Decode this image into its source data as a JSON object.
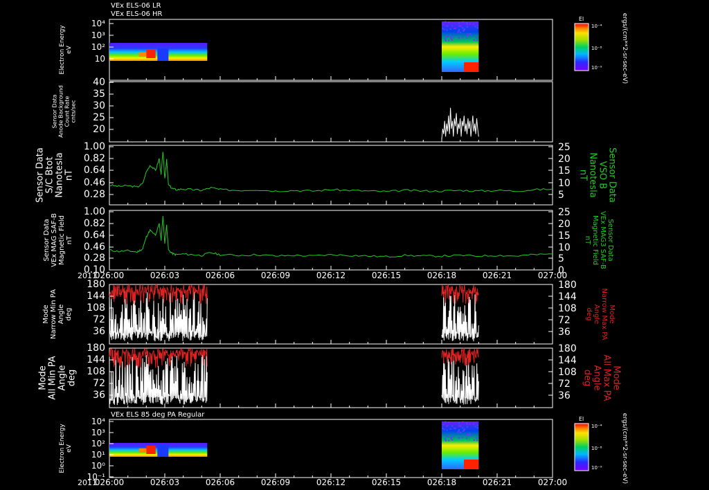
{
  "chart_data": {
    "type": "line",
    "title_lines": [
      "VEx ELS-06 LR",
      "VEx ELS-06 HR"
    ],
    "bottom_title": "VEx ELS 85 deg PA Regular",
    "year": "2011",
    "time_labels": [
      "026:00",
      "026:03",
      "026:06",
      "026:09",
      "026:12",
      "026:15",
      "026:18",
      "026:21",
      "027:00"
    ],
    "panels": [
      {
        "id": "spec1",
        "kind": "spectrogram",
        "ylabel": [
          "Electron Energy",
          "eV"
        ],
        "yticks": [
          "10⁴",
          "10³",
          "10²",
          "10"
        ],
        "colorbar": {
          "title": "El",
          "ticks": [
            "10⁻⁴",
            "10⁻⁸",
            "10⁻⁹"
          ],
          "unit": "ergs/(cm**2-sr-sec-eV)"
        },
        "data_blocks": [
          {
            "t_start": "026:00",
            "t_end": "026:05.3",
            "content": "low-energy flux, peak near 026:02-026:03"
          },
          {
            "t_start": "026:18",
            "t_end": "026:20",
            "content": "broad-energy flux, peak near 026:19.5"
          }
        ]
      },
      {
        "id": "bkg",
        "kind": "line",
        "ylabel": [
          "Sensor Data",
          "Anode Background",
          "Count Rate",
          "cnts/sec"
        ],
        "ylim": [
          17,
          40
        ],
        "yticks": [
          "40",
          "35",
          "30",
          "25",
          "20"
        ],
        "series": [
          {
            "color": "#ffffff",
            "x_start": 18.0,
            "x_end": 20.0,
            "values": [
              18,
              22,
              20,
              25,
              19,
              24,
              21,
              27,
              20,
              30,
              22,
              25,
              19,
              26,
              23,
              28,
              20,
              24,
              22,
              26,
              19,
              25,
              23,
              27,
              21,
              24,
              20,
              26,
              22,
              25,
              19,
              23,
              27,
              21,
              24,
              20,
              26,
              22,
              19
            ]
          }
        ]
      },
      {
        "id": "bsc",
        "kind": "line",
        "ylabel": [
          "Sensor Data",
          "S/C Btot",
          "Nanotesla",
          "nT"
        ],
        "ylim_left": [
          0.1,
          1.0
        ],
        "yticks_left": [
          "1.00",
          "0.82",
          "0.64",
          "0.46",
          "0.28"
        ],
        "ylabel_right": [
          "Sensor Data",
          "VSO B",
          "Nanotesla",
          "nT"
        ],
        "yticks_right": [
          "25",
          "20",
          "15",
          "10",
          "5"
        ],
        "series": [
          {
            "color": "#22cc22",
            "x": [
              0,
              0.5,
              1,
              1.5,
              1.8,
              2.0,
              2.2,
              2.5,
              2.7,
              2.8,
              2.9,
              3.0,
              3.1,
              3.2,
              3.4,
              3.6,
              4,
              4.5,
              5,
              5.5,
              6,
              7,
              8,
              9,
              10,
              11,
              12,
              13,
              14,
              15,
              16,
              17,
              18,
              19,
              20,
              21,
              22,
              23,
              24
            ],
            "y": [
              0.4,
              0.38,
              0.39,
              0.37,
              0.42,
              0.6,
              0.7,
              0.62,
              0.8,
              0.55,
              0.91,
              0.5,
              0.78,
              0.4,
              0.35,
              0.33,
              0.34,
              0.33,
              0.32,
              0.36,
              0.33,
              0.32,
              0.33,
              0.31,
              0.32,
              0.31,
              0.33,
              0.32,
              0.31,
              0.3,
              0.32,
              0.31,
              0.31,
              0.32,
              0.31,
              0.32,
              0.31,
              0.33,
              0.34
            ]
          }
        ]
      },
      {
        "id": "bmag",
        "kind": "line",
        "ylabel": [
          "Sensor Data",
          "VEx MAG SAF-B",
          "Magnetic Field",
          "nT"
        ],
        "ylim_left": [
          0.1,
          1.0
        ],
        "yticks_left": [
          "1.00",
          "0.82",
          "0.64",
          "0.46",
          "0.28",
          "0.10"
        ],
        "ylabel_right": [
          "Sensor Data",
          "VEx MAG3 SAF-B",
          "Magnetic Field",
          "nT"
        ],
        "yticks_right": [
          "25",
          "20",
          "15",
          "10",
          "5",
          "0"
        ],
        "series": [
          {
            "color": "#22cc22",
            "x": [
              0,
              0.5,
              1,
              1.5,
              1.8,
              2.0,
              2.2,
              2.5,
              2.7,
              2.8,
              2.9,
              3.0,
              3.1,
              3.2,
              3.4,
              3.6,
              4,
              4.5,
              5,
              5.5,
              6,
              7,
              8,
              9,
              10,
              11,
              12,
              13,
              14,
              15,
              16,
              17,
              18,
              19,
              20,
              21,
              22,
              23,
              24
            ],
            "y": [
              0.4,
              0.38,
              0.39,
              0.37,
              0.42,
              0.6,
              0.7,
              0.62,
              0.8,
              0.55,
              0.91,
              0.5,
              0.78,
              0.4,
              0.35,
              0.33,
              0.34,
              0.33,
              0.32,
              0.36,
              0.33,
              0.32,
              0.33,
              0.31,
              0.32,
              0.31,
              0.33,
              0.32,
              0.31,
              0.3,
              0.32,
              0.31,
              0.31,
              0.32,
              0.31,
              0.32,
              0.31,
              0.33,
              0.34
            ]
          }
        ]
      },
      {
        "id": "pan",
        "kind": "line",
        "ylabel": [
          "Mode",
          "Narrow Min PA",
          "Angle",
          "deg"
        ],
        "ylim": [
          0,
          180
        ],
        "yticks": [
          "180",
          "144",
          "108",
          "72",
          "36"
        ],
        "ylabel_right": [
          "Mode",
          "Narrow Max PA",
          "Angle",
          "deg"
        ],
        "yticks_right": [
          "180",
          "144",
          "108",
          "72",
          "36"
        ],
        "series": [
          {
            "name": "min",
            "color": "#ffffff",
            "segments": [
              [
                0,
                5.3
              ],
              [
                18,
                20
              ]
            ]
          },
          {
            "name": "max",
            "color": "#dd2222",
            "segments": [
              [
                0,
                5.3
              ],
              [
                18,
                20
              ]
            ]
          }
        ]
      },
      {
        "id": "paa",
        "kind": "line",
        "ylabel": [
          "Mode",
          "All Min PA",
          "Angle",
          "deg"
        ],
        "ylim": [
          0,
          180
        ],
        "yticks": [
          "180",
          "144",
          "108",
          "72",
          "36"
        ],
        "ylabel_right": [
          "Mode",
          "All Max PA",
          "Angle",
          "deg"
        ],
        "yticks_right": [
          "180",
          "144",
          "108",
          "72",
          "36"
        ],
        "series": [
          {
            "name": "min",
            "color": "#ffffff",
            "segments": [
              [
                0,
                5.3
              ],
              [
                18,
                20
              ]
            ]
          },
          {
            "name": "max",
            "color": "#dd2222",
            "segments": [
              [
                0,
                5.3
              ],
              [
                18,
                20
              ]
            ]
          }
        ]
      },
      {
        "id": "spec2",
        "kind": "spectrogram",
        "ylabel": [
          "Electron Energy",
          "eV"
        ],
        "yticks": [
          "10⁴",
          "10³",
          "10²",
          "10¹",
          "10⁰",
          "10⁻¹"
        ],
        "colorbar": {
          "title": "El",
          "ticks": [
            "10⁻⁴",
            "10⁻⁸",
            "10⁻⁹"
          ],
          "unit": "ergs/(cm**2-sr-sec-eV)"
        },
        "data_blocks": [
          {
            "t_start": "026:00",
            "t_end": "026:05.3",
            "content": "low-energy flux, peak near 026:02-026:03"
          },
          {
            "t_start": "026:18",
            "t_end": "026:20",
            "content": "broad-energy flux, peak near 026:19.5"
          }
        ]
      }
    ]
  }
}
